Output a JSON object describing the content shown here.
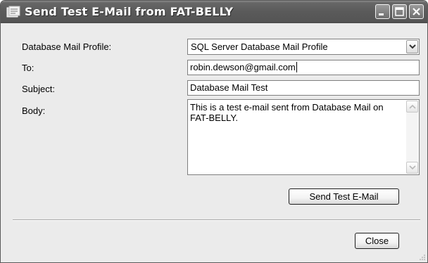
{
  "window": {
    "title": "Send Test E-Mail from FAT-BELLY",
    "controls": [
      "minimize-icon",
      "maximize-icon",
      "close-icon"
    ]
  },
  "form": {
    "profile_label": "Database Mail Profile:",
    "profile_value": "SQL Server Database Mail Profile",
    "to_label": "To:",
    "to_value": "robin.dewson@gmail.com",
    "subject_label": "Subject:",
    "subject_value": "Database Mail Test",
    "body_label": "Body:",
    "body_value": "This is a test e-mail sent from Database Mail on FAT-BELLY."
  },
  "buttons": {
    "send_label": "Send Test E-Mail",
    "close_label": "Close"
  }
}
